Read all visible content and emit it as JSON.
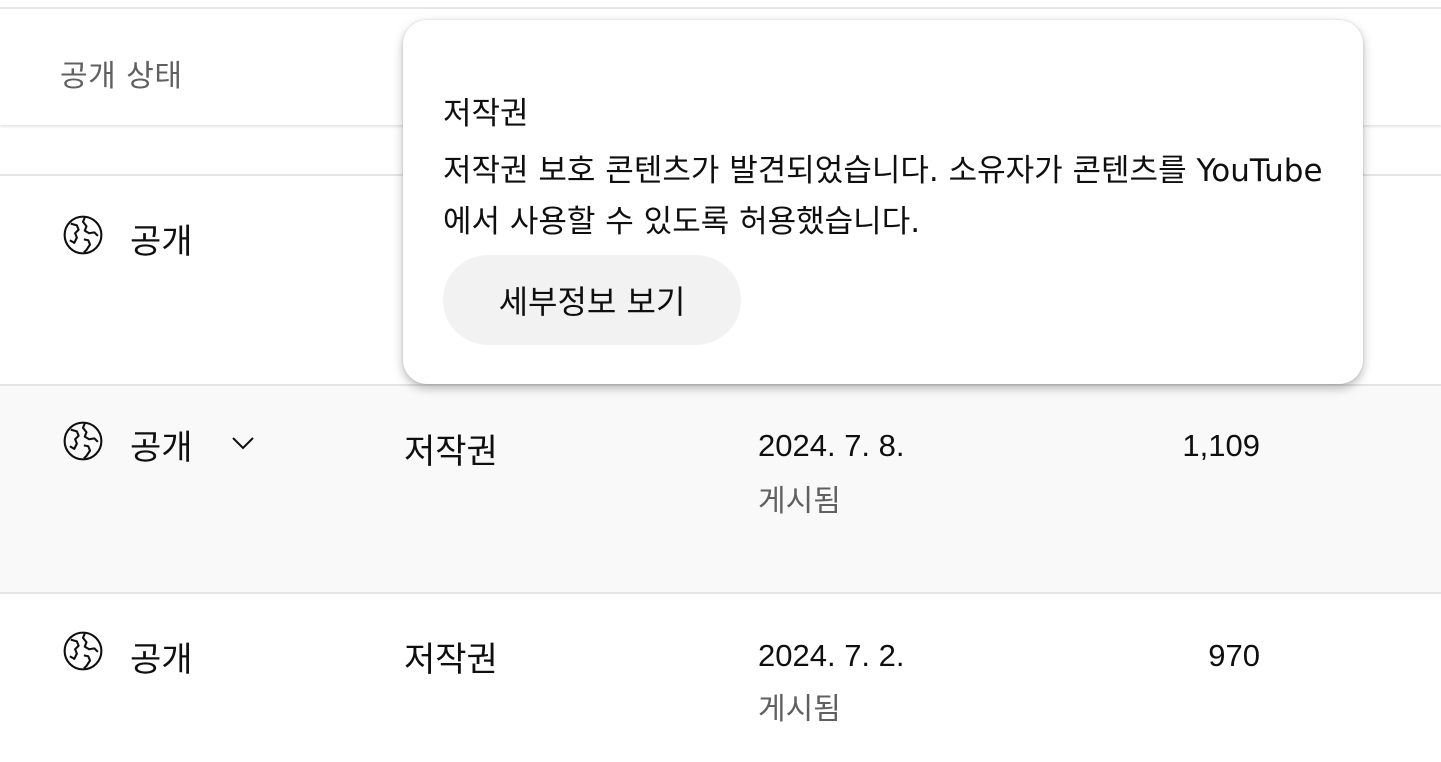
{
  "header": {
    "visibility_column": "공개 상태"
  },
  "rows": [
    {
      "visibility": "공개",
      "globe_icon": "globe-icon"
    },
    {
      "visibility": "공개",
      "globe_icon": "globe-icon",
      "dropdown_icon": "chevron-down-icon",
      "restriction": "저작권",
      "date": "2024. 7. 8.",
      "date_status": "게시됨",
      "views": "1,109"
    },
    {
      "visibility": "공개",
      "globe_icon": "globe-icon",
      "restriction": "저작권",
      "date": "2024. 7. 2.",
      "date_status": "게시됨",
      "views": "970"
    }
  ],
  "tooltip": {
    "title": "저작권",
    "body": "저작권 보호 콘텐츠가 발견되었습니다. 소유자가 콘텐츠를 YouTube에서 사용할 수 있도록 허용했습니다.",
    "details_button": "세부정보 보기"
  },
  "colors": {
    "row_hover_bg": "#f9f9f9",
    "divider": "#e5e5e5",
    "secondary_text": "#606060",
    "button_bg": "#f2f2f2"
  }
}
